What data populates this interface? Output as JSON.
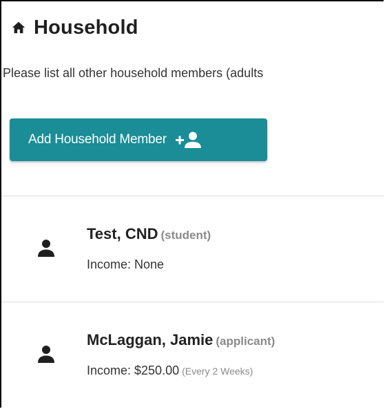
{
  "header": {
    "icon": "home-icon",
    "title": "Household"
  },
  "intro": {
    "text": "Please list all other household members (adults"
  },
  "add_button": {
    "label": "Add Household Member",
    "icon": "add-person-icon",
    "color": "#1a8d97"
  },
  "members": [
    {
      "name": "Test, CND",
      "role": "(student)",
      "income_label": "Income: None",
      "frequency": ""
    },
    {
      "name": "McLaggan, Jamie",
      "role": "(applicant)",
      "income_label": "Income: $250.00",
      "frequency": "(Every 2 Weeks)"
    }
  ]
}
